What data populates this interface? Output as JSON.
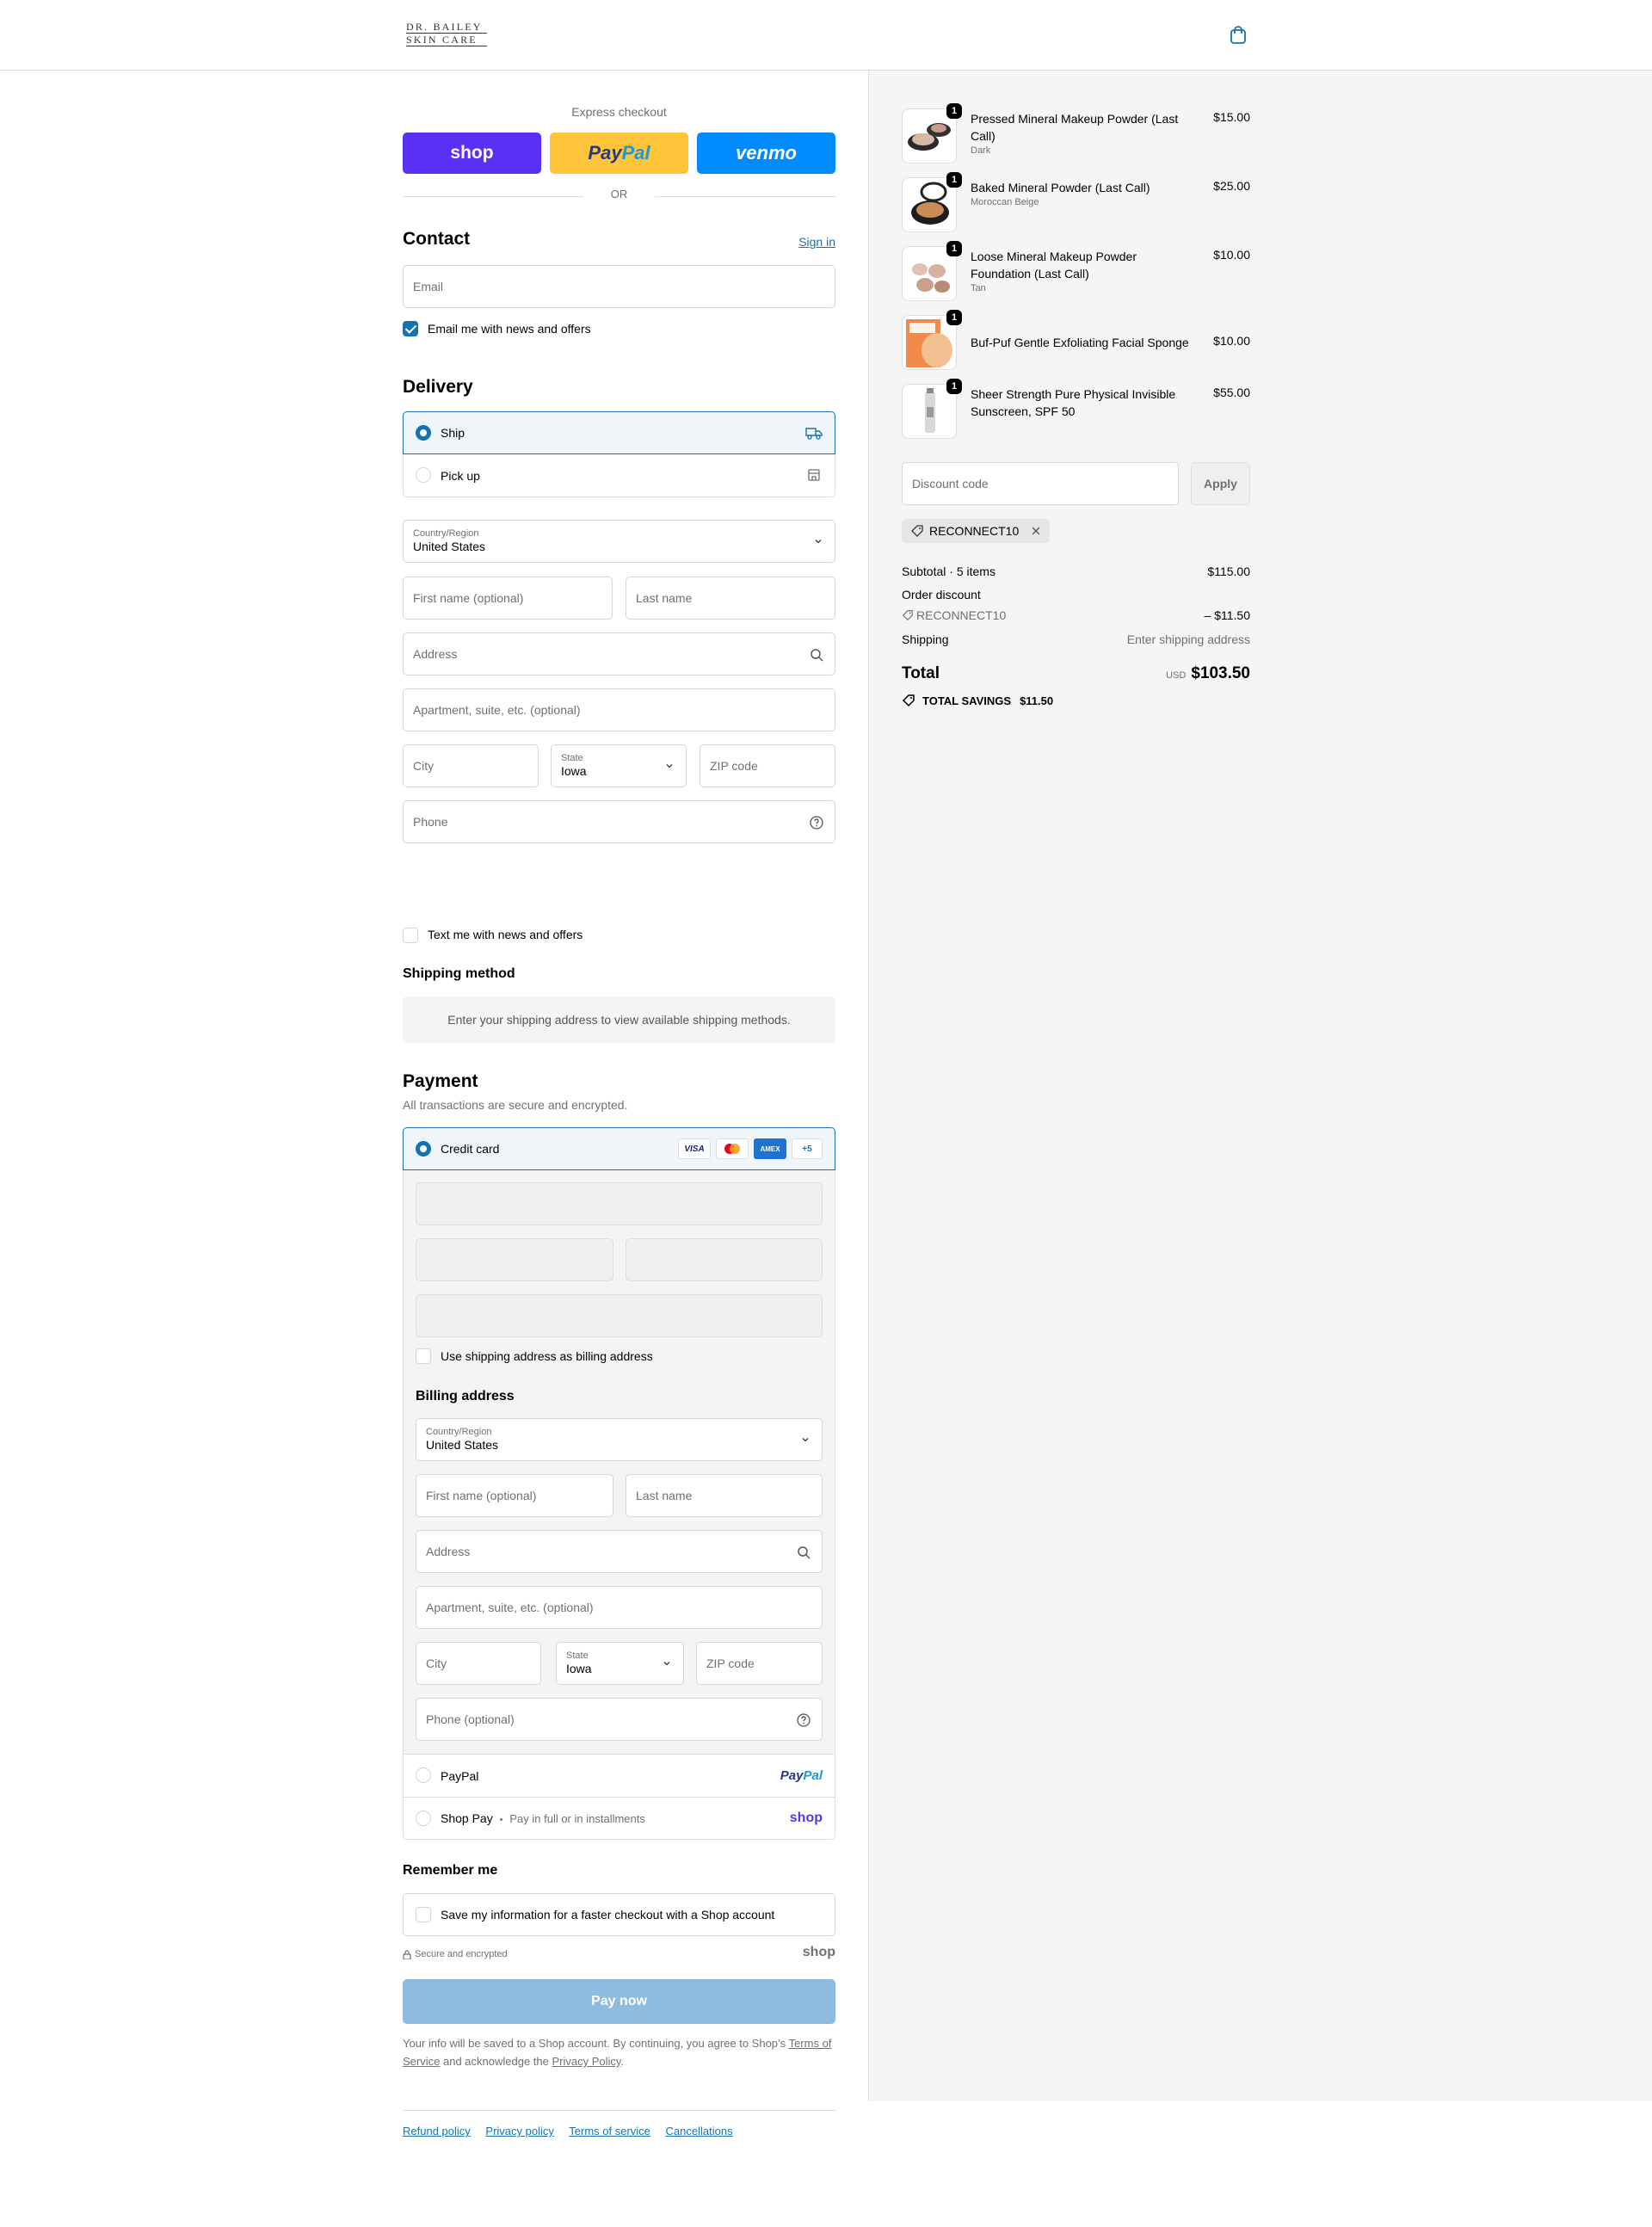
{
  "header": {
    "logo_line1": "DR. BAILEY",
    "logo_line2": "SKIN CARE"
  },
  "express": {
    "label": "Express checkout",
    "shop": "shop",
    "paypal_pay": "Pay",
    "paypal_pal": "Pal",
    "venmo": "venmo",
    "or": "OR"
  },
  "contact": {
    "title": "Contact",
    "sign_in": "Sign in",
    "email_placeholder": "Email",
    "news_label": "Email me with news and offers"
  },
  "delivery": {
    "title": "Delivery",
    "ship": "Ship",
    "pickup": "Pick up",
    "country_label": "Country/Region",
    "country_value": "United States",
    "first_name": "First name (optional)",
    "last_name": "Last name",
    "address": "Address",
    "apartment": "Apartment, suite, etc. (optional)",
    "city": "City",
    "state_label": "State",
    "state_value": "Iowa",
    "zip": "ZIP code",
    "phone": "Phone",
    "text_label": "Text me with news and offers"
  },
  "shipping_method": {
    "title": "Shipping method",
    "message": "Enter your shipping address to view available shipping methods."
  },
  "payment": {
    "title": "Payment",
    "subtitle": "All transactions are secure and encrypted.",
    "credit_card": "Credit card",
    "visa": "VISA",
    "amex": "AMEX",
    "more": "+5",
    "use_shipping": "Use shipping address as billing address",
    "paypal": "PayPal",
    "paypal_pay": "Pay",
    "paypal_pal": "Pal",
    "shop_pay": "Shop Pay",
    "shop_pay_sep": "•",
    "shop_pay_sub": "Pay in full or in installments",
    "shop_logo": "shop"
  },
  "billing": {
    "title": "Billing address",
    "country_label": "Country/Region",
    "country_value": "United States",
    "first_name": "First name (optional)",
    "last_name": "Last name",
    "address": "Address",
    "apartment": "Apartment, suite, etc. (optional)",
    "city": "City",
    "state_label": "State",
    "state_value": "Iowa",
    "zip": "ZIP code",
    "phone": "Phone (optional)"
  },
  "remember": {
    "title": "Remember me",
    "save_label": "Save my information for a faster checkout with a Shop account",
    "secure": "Secure and encrypted",
    "shop_logo": "shop"
  },
  "pay_now": "Pay now",
  "legal": {
    "line1": "Your info will be saved to a Shop account. By continuing, you agree to Shop’s",
    "tos": "Terms of Service",
    "middle": "and acknowledge the",
    "privacy": "Privacy Policy",
    "end": "."
  },
  "footer_links": [
    "Refund policy",
    "Privacy policy",
    "Terms of service",
    "Cancellations"
  ],
  "order": {
    "items": [
      {
        "qty": "1",
        "name": "Pressed Mineral Makeup Powder (Last Call)",
        "variant": "Dark",
        "price": "$15.00"
      },
      {
        "qty": "1",
        "name": "Baked Mineral Powder (Last Call)",
        "variant": "Moroccan Beige",
        "price": "$25.00"
      },
      {
        "qty": "1",
        "name": "Loose Mineral Makeup Powder Foundation (Last Call)",
        "variant": "Tan",
        "price": "$10.00"
      },
      {
        "qty": "1",
        "name": "Buf-Puf Gentle Exfoliating Facial Sponge",
        "variant": "",
        "price": "$10.00"
      },
      {
        "qty": "1",
        "name": "Sheer Strength Pure Physical Invisible Sunscreen, SPF 50",
        "variant": "",
        "price": "$55.00"
      }
    ],
    "discount_placeholder": "Discount code",
    "apply": "Apply",
    "applied_code": "RECONNECT10",
    "subtotal_label": "Subtotal · 5 items",
    "subtotal": "$115.00",
    "order_discount_label": "Order discount",
    "discount_code": "RECONNECT10",
    "discount_value": "– $11.50",
    "shipping_label": "Shipping",
    "shipping_value": "Enter shipping address",
    "total_label": "Total",
    "currency": "USD",
    "total": "$103.50",
    "savings_label": "TOTAL SAVINGS",
    "savings_value": "$11.50"
  },
  "colors": {
    "accent": "#1773b0",
    "shop": "#5a31f4",
    "paypal": "#ffc439",
    "venmo": "#008cff",
    "pay_disabled": "#8fbbdf"
  }
}
